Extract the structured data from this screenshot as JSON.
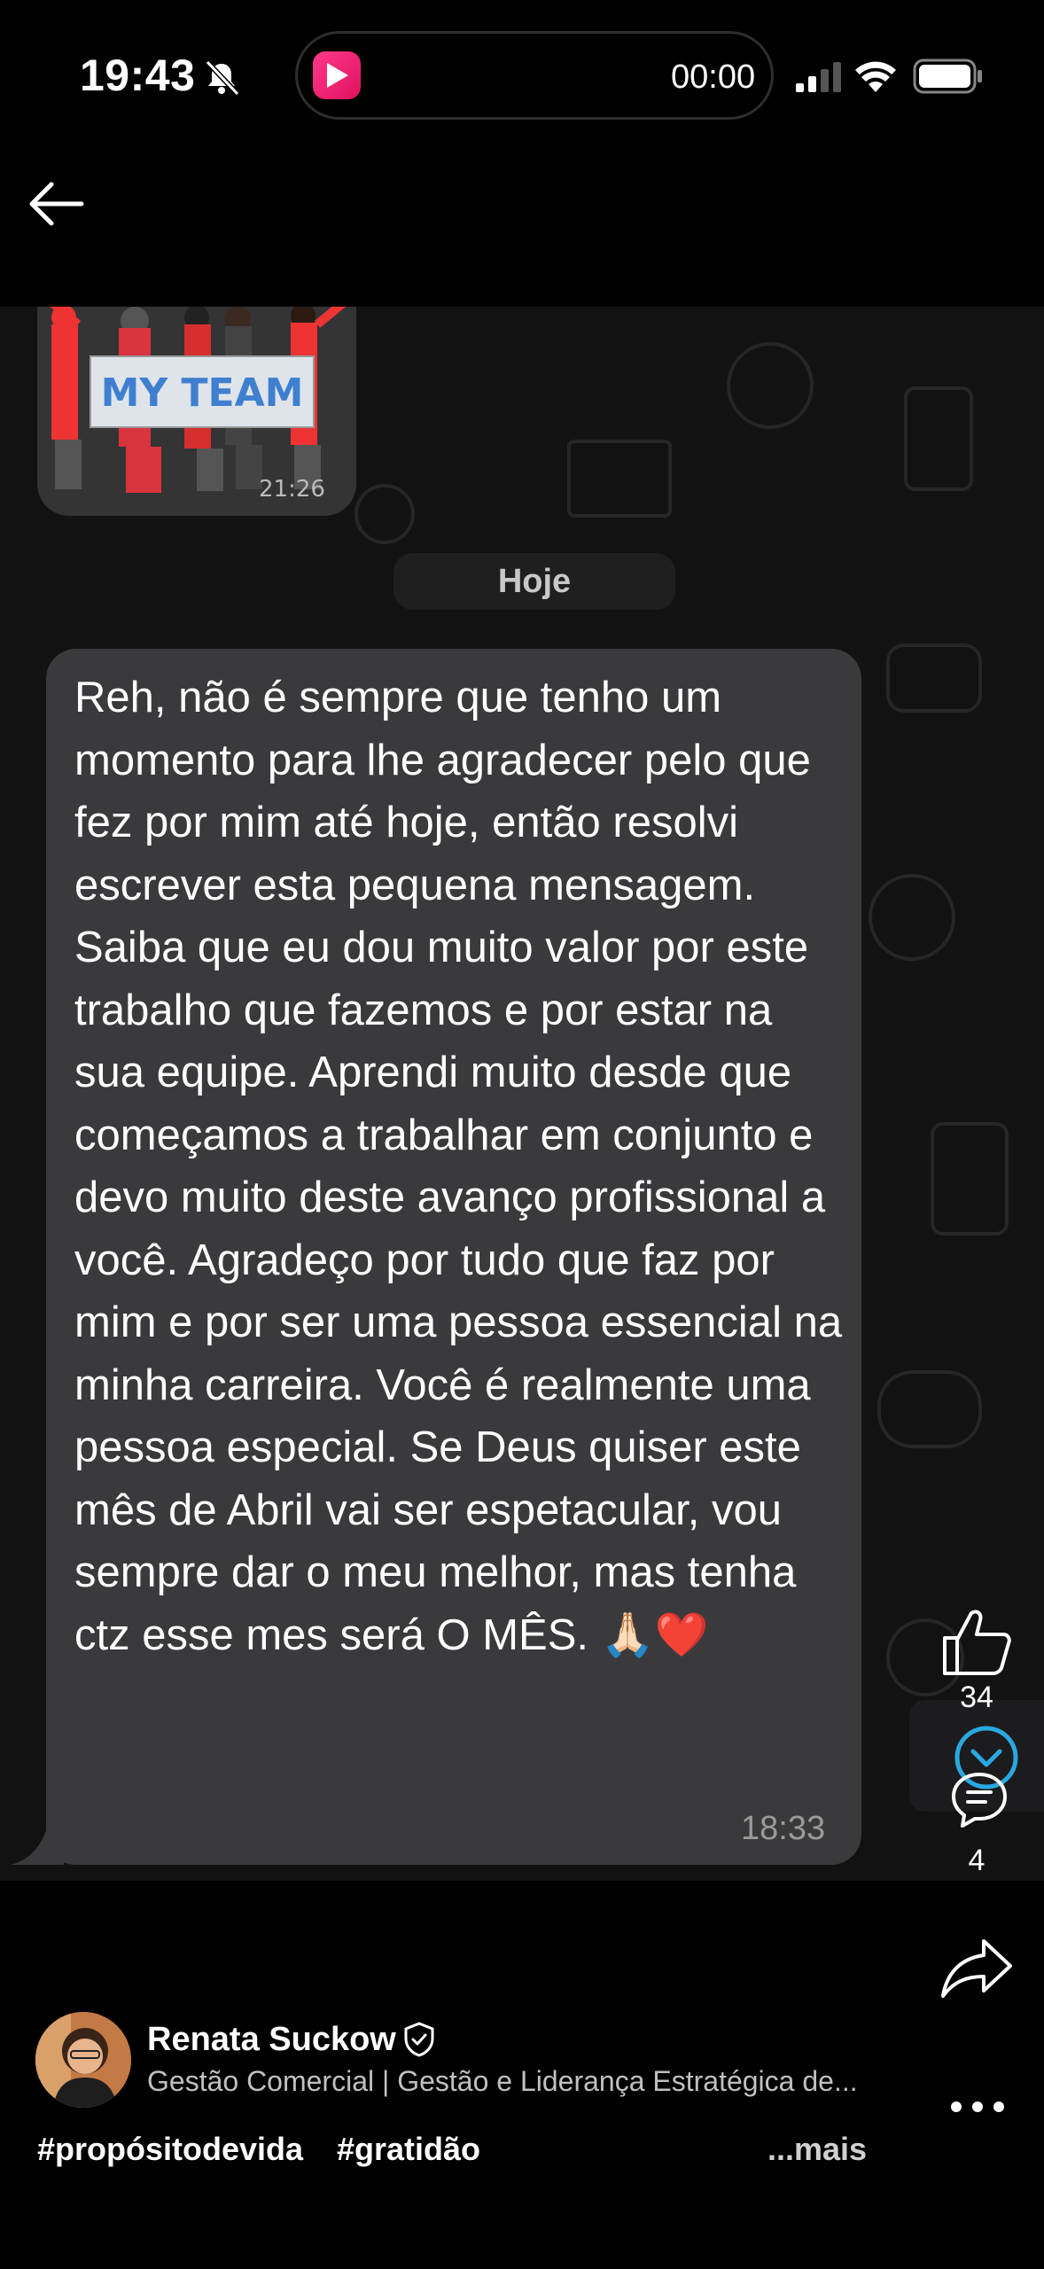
{
  "status_bar": {
    "time": "19:43",
    "island_timer": "00:00"
  },
  "chat": {
    "sticker_text": "MY TEAM",
    "sticker_time": "21:26",
    "date_label": "Hoje",
    "message": "Reh, não é sempre que tenho um momento para lhe agradecer pelo que fez por mim até hoje, então resolvi escrever esta pequena mensagem. Saiba que eu dou muito valor por este trabalho que fazemos e por estar na sua equipe. Aprendi muito desde que começamos a trabalhar em conjunto e devo muito deste avanço profissional a você. Agradeço por tudo que faz por mim e por ser uma pessoa essencial na minha carreira. Você é realmente uma pessoa especial. Se Deus quiser este mês de Abril vai ser espetacular, vou sempre dar o meu melhor, mas tenha ctz esse mes será O MÊS. 🙏🏻❤️",
    "message_time": "18:33"
  },
  "actions": {
    "likes": "34",
    "comments": "4"
  },
  "author": {
    "name": "Renata Suckow",
    "headline": "Gestão Comercial | Gestão e Liderança Estratégica de..."
  },
  "caption": {
    "hashtags": [
      "#propósitodevida",
      "#gratidão"
    ],
    "more_label": "...mais"
  },
  "colors": {
    "bubble": "#3a3a3c",
    "chat_bg": "#121212",
    "accent_blue": "#2aa8e0"
  },
  "icons": [
    "bell-off-icon",
    "back-arrow-icon",
    "like-icon",
    "comment-icon",
    "share-icon",
    "more-icon",
    "verified-icon",
    "scroll-down-icon"
  ]
}
